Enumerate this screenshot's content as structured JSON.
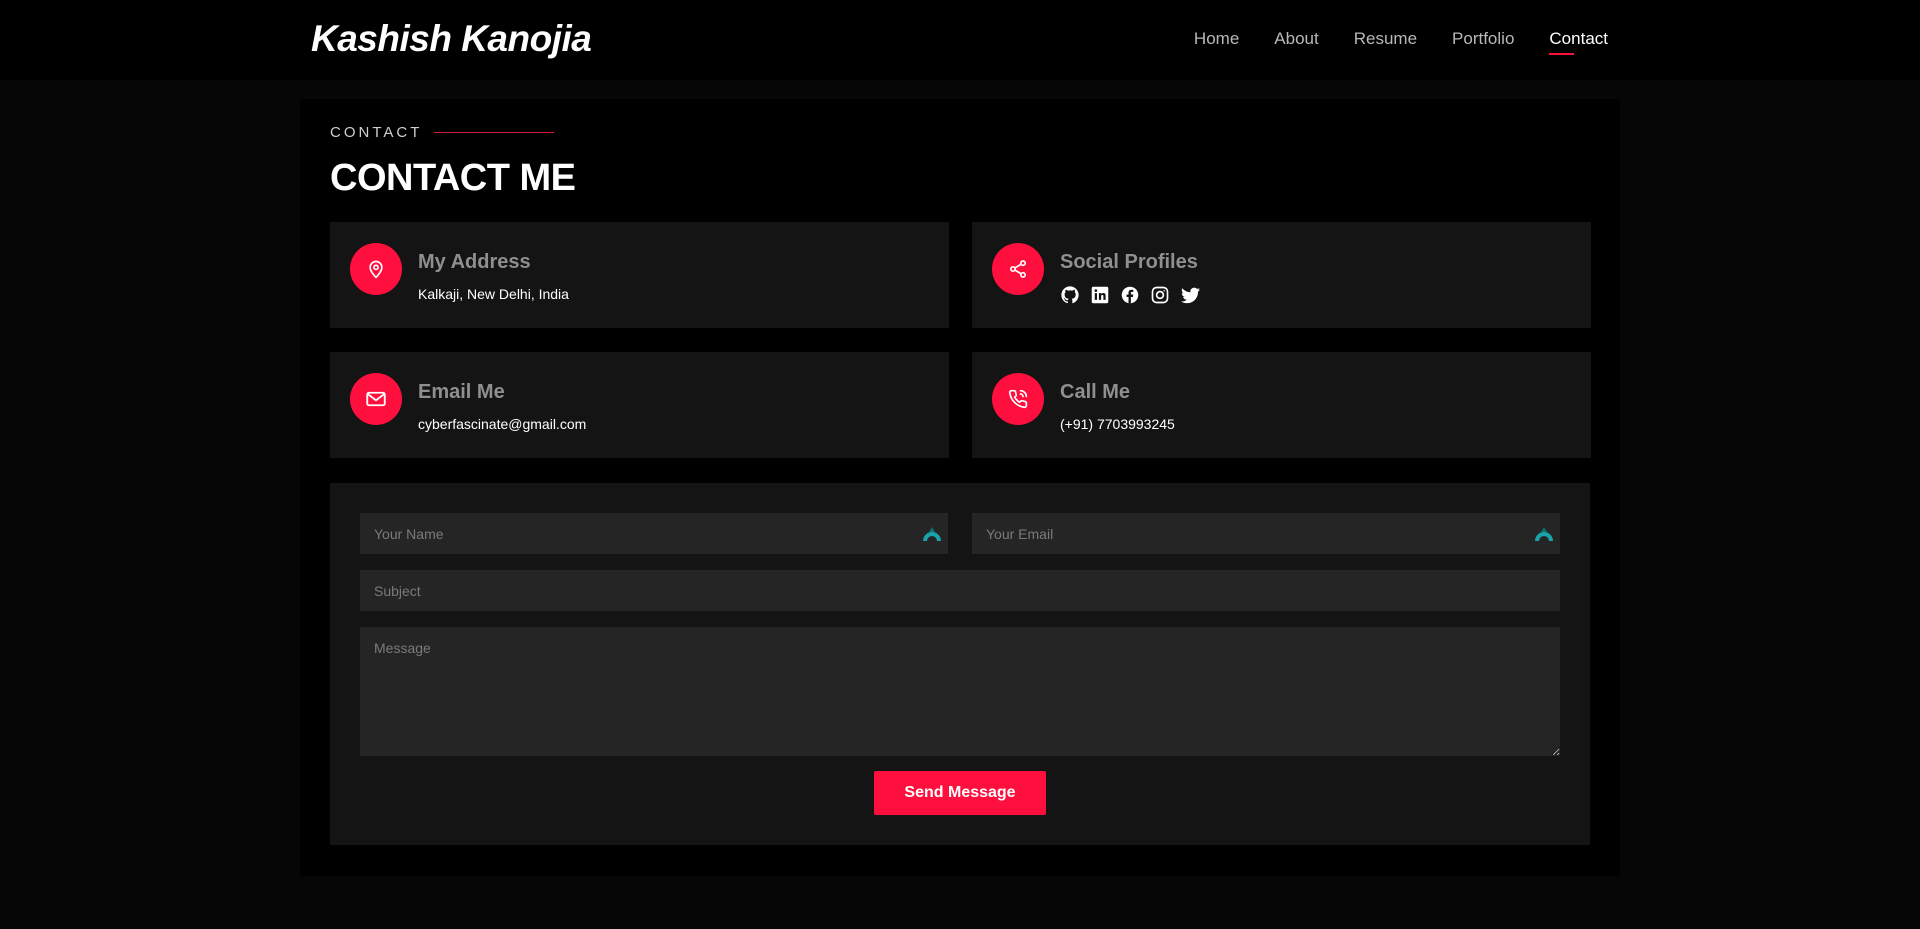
{
  "header": {
    "logo": "Kashish Kanojia",
    "nav": [
      {
        "label": "Home"
      },
      {
        "label": "About"
      },
      {
        "label": "Resume"
      },
      {
        "label": "Portfolio"
      },
      {
        "label": "Contact"
      }
    ],
    "active_nav": "Contact"
  },
  "section": {
    "eyebrow": "CONTACT",
    "title": "CONTACT ME"
  },
  "info": {
    "address": {
      "title": "My Address",
      "text": "Kalkaji, New Delhi, India",
      "icon": "map-pin-icon"
    },
    "social": {
      "title": "Social Profiles",
      "icon": "share-icon",
      "links": [
        "github-icon",
        "linkedin-icon",
        "facebook-icon",
        "instagram-icon",
        "twitter-icon"
      ]
    },
    "email": {
      "title": "Email Me",
      "text": "cyberfascinate@gmail.com",
      "icon": "envelope-icon"
    },
    "phone": {
      "title": "Call Me",
      "text": "(+91) 7703993245",
      "icon": "phone-icon"
    }
  },
  "form": {
    "name_placeholder": "Your Name",
    "email_placeholder": "Your Email",
    "subject_placeholder": "Subject",
    "message_placeholder": "Message",
    "submit_label": "Send Message"
  },
  "colors": {
    "accent": "#ff0f3d",
    "background": "#060606",
    "card": "#141414",
    "input": "#252525"
  }
}
